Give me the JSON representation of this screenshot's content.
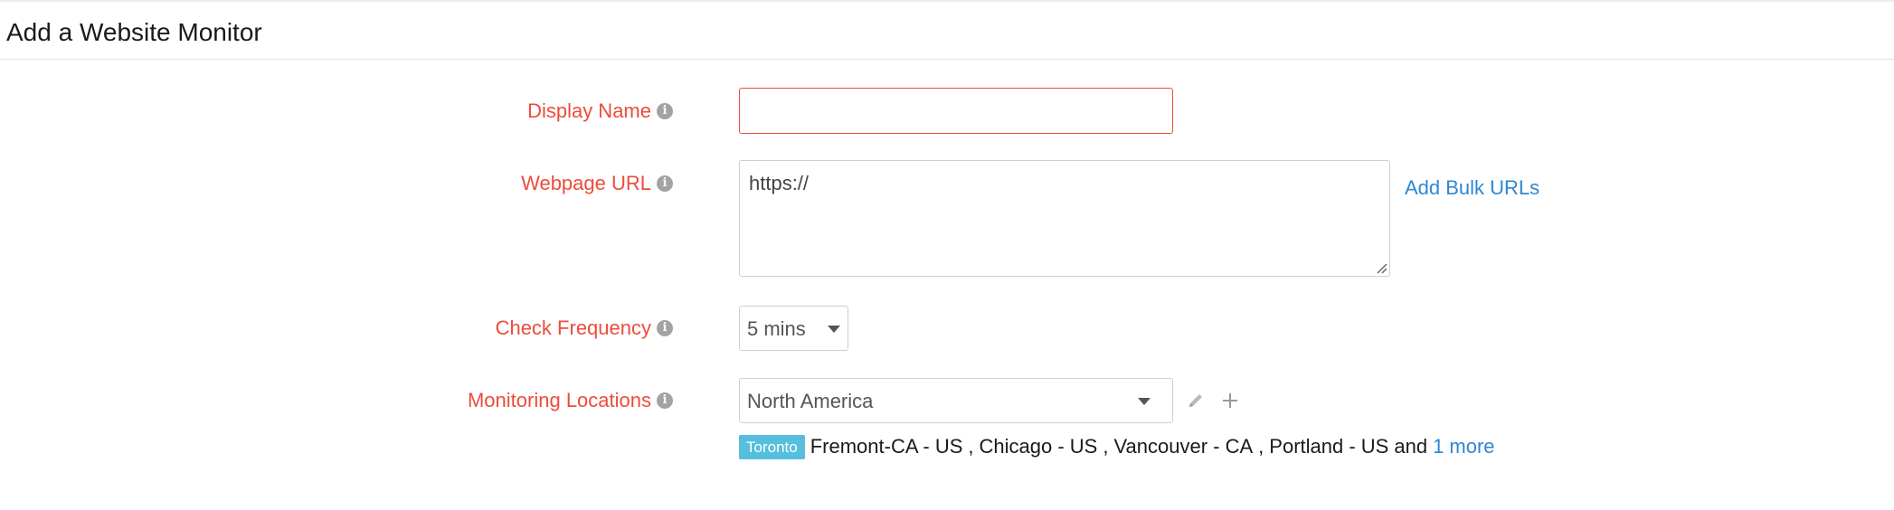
{
  "header": {
    "title": "Add a Website Monitor"
  },
  "form": {
    "display_name": {
      "label": "Display Name",
      "value": "",
      "info_icon": "info-icon"
    },
    "webpage_url": {
      "label": "Webpage URL",
      "value": "https://",
      "info_icon": "info-icon",
      "bulk_link": "Add Bulk URLs"
    },
    "check_frequency": {
      "label": "Check Frequency",
      "value": "5 mins",
      "info_icon": "info-icon"
    },
    "monitoring_locations": {
      "label": "Monitoring Locations",
      "value": "North America",
      "info_icon": "info-icon",
      "edit_icon": "pencil-icon",
      "add_icon": "plus-icon",
      "primary_badge": "Toronto",
      "locations": [
        "Fremont-CA - US",
        "Chicago - US",
        "Vancouver - CA",
        "Portland - US"
      ],
      "separator": ",",
      "conjunction": "and",
      "more_link": "1 more"
    }
  },
  "colors": {
    "required_label": "#ec4c3c",
    "link": "#2d87d4",
    "badge": "#56bfdd",
    "info_icon": "#a3a3a3"
  }
}
